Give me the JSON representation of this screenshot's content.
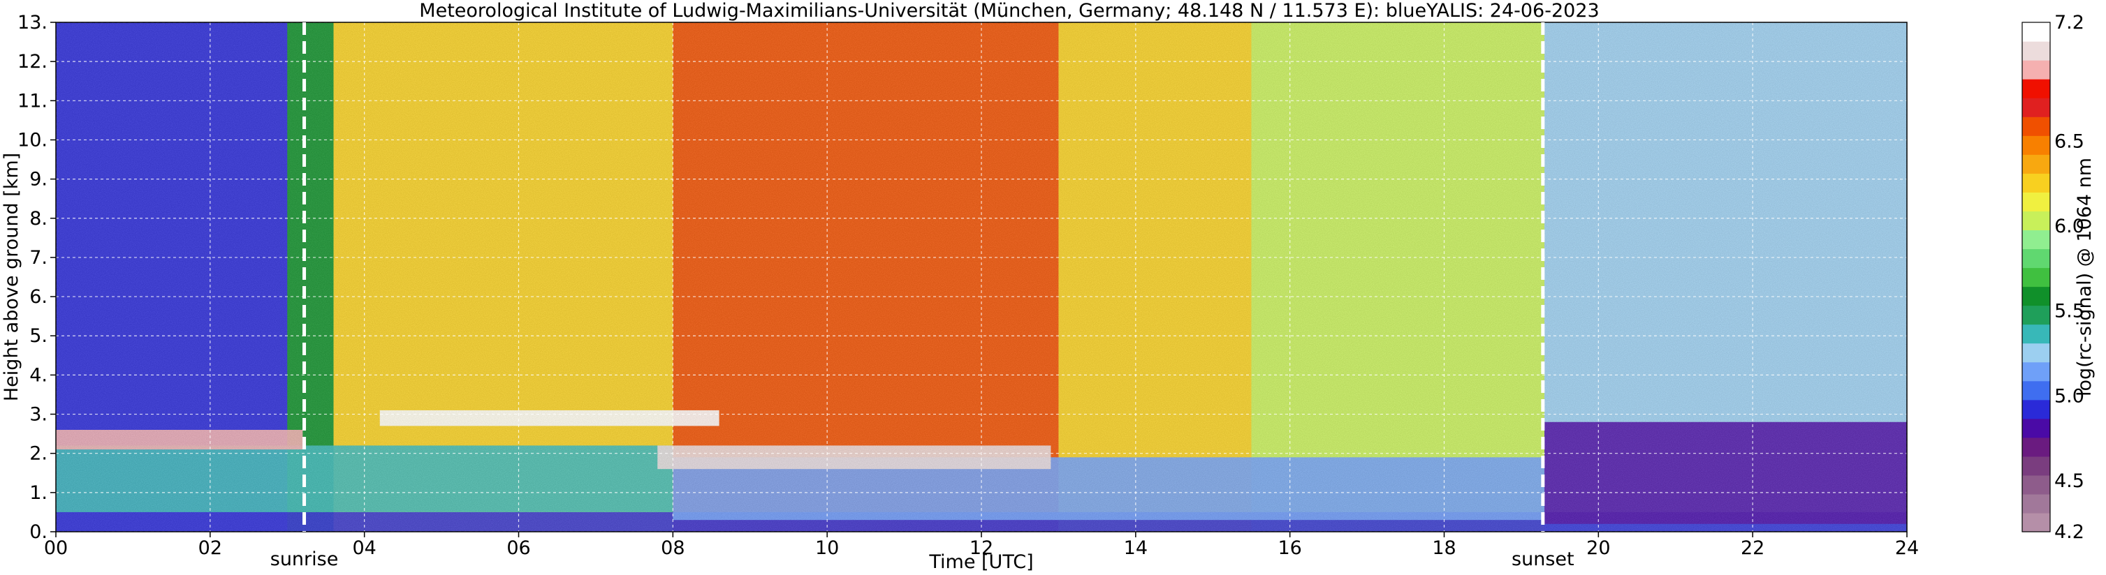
{
  "chart_data": {
    "type": "heatmap",
    "title": "Meteorological Institute of Ludwig-Maximilians-Universität (München, Germany; 48.148 N / 11.573 E):    blueYALIS: 24-06-2023",
    "xlabel": "Time [UTC]",
    "ylabel": "Height above ground [km]",
    "xlim": [
      0,
      24
    ],
    "ylim": [
      0,
      13
    ],
    "x_ticks": [
      0,
      2,
      4,
      6,
      8,
      10,
      12,
      14,
      16,
      18,
      20,
      22,
      24
    ],
    "x_tick_labels": [
      "00",
      "02",
      "04",
      "06",
      "08",
      "10",
      "12",
      "14",
      "16",
      "18",
      "20",
      "22",
      "24"
    ],
    "y_ticks": [
      0,
      1,
      2,
      3,
      4,
      5,
      6,
      7,
      8,
      9,
      10,
      11,
      12,
      13
    ],
    "y_tick_labels": [
      "0.",
      "1.",
      "2.",
      "3.",
      "4.",
      "5.",
      "6.",
      "7.",
      "8.",
      "9.",
      "10.",
      "11.",
      "12.",
      "13."
    ],
    "grid": true,
    "vlines": [
      {
        "x": 3.22,
        "label": "sunrise"
      },
      {
        "x": 19.28,
        "label": "sunset"
      }
    ],
    "colorbar": {
      "label": "log(rc-signal) @ 1064 nm",
      "range": [
        4.2,
        7.2
      ],
      "tick_values": [
        4.2,
        4.5,
        5.0,
        5.5,
        6.0,
        6.5,
        7.2
      ],
      "tick_labels": [
        "4.2",
        "4.5",
        "5.0",
        "5.5",
        "6.0",
        "6.5",
        "7.2"
      ],
      "colors": [
        "#b58fa8",
        "#a1789a",
        "#8e5c8b",
        "#7a3d7f",
        "#6a1b80",
        "#4a0aa6",
        "#2a2ad8",
        "#3f6ef0",
        "#6fa0f8",
        "#9ccff0",
        "#38b8b8",
        "#1f9f5a",
        "#10902a",
        "#40c040",
        "#60d870",
        "#90ee90",
        "#c8f05a",
        "#f0f040",
        "#f8d020",
        "#f8a810",
        "#f88000",
        "#f05000",
        "#e02020",
        "#f01000",
        "#f5b0b0",
        "#ecdcdc",
        "#ffffff"
      ]
    },
    "background_levels": [
      {
        "x0": 0,
        "x1": 3.0,
        "level": 4.9
      },
      {
        "x0": 3.0,
        "x1": 3.6,
        "level": 5.6
      },
      {
        "x0": 3.6,
        "x1": 8.0,
        "level": 6.3
      },
      {
        "x0": 8.0,
        "x1": 13.0,
        "level": 6.6
      },
      {
        "x0": 13.0,
        "x1": 15.5,
        "level": 6.3
      },
      {
        "x0": 15.5,
        "x1": 19.3,
        "level": 6.0
      },
      {
        "x0": 19.3,
        "x1": 24,
        "level": 5.3
      }
    ],
    "features": [
      {
        "name": "surface layer",
        "x0": 0,
        "x1": 24,
        "y0": 0.0,
        "y1": 0.5,
        "level": 4.9
      },
      {
        "name": "aerosol layer",
        "x0": 0,
        "x1": 8.0,
        "y0": 0.5,
        "y1": 2.2,
        "level": 5.4
      },
      {
        "name": "aerosol layer",
        "x0": 8.0,
        "x1": 19.3,
        "y0": 0.3,
        "y1": 1.9,
        "level": 5.1
      },
      {
        "name": "residual layer",
        "x0": 19.3,
        "x1": 24,
        "y0": 0.2,
        "y1": 2.8,
        "level": 4.8
      },
      {
        "name": "cloud layer",
        "x0": 0,
        "x1": 3.2,
        "y0": 2.1,
        "y1": 2.6,
        "level": 6.9
      },
      {
        "name": "cloud layer",
        "x0": 4.2,
        "x1": 8.6,
        "y0": 2.7,
        "y1": 3.1,
        "level": 7.1
      },
      {
        "name": "cloud layer",
        "x0": 7.8,
        "x1": 12.9,
        "y0": 1.6,
        "y1": 2.2,
        "level": 7.0
      }
    ]
  }
}
